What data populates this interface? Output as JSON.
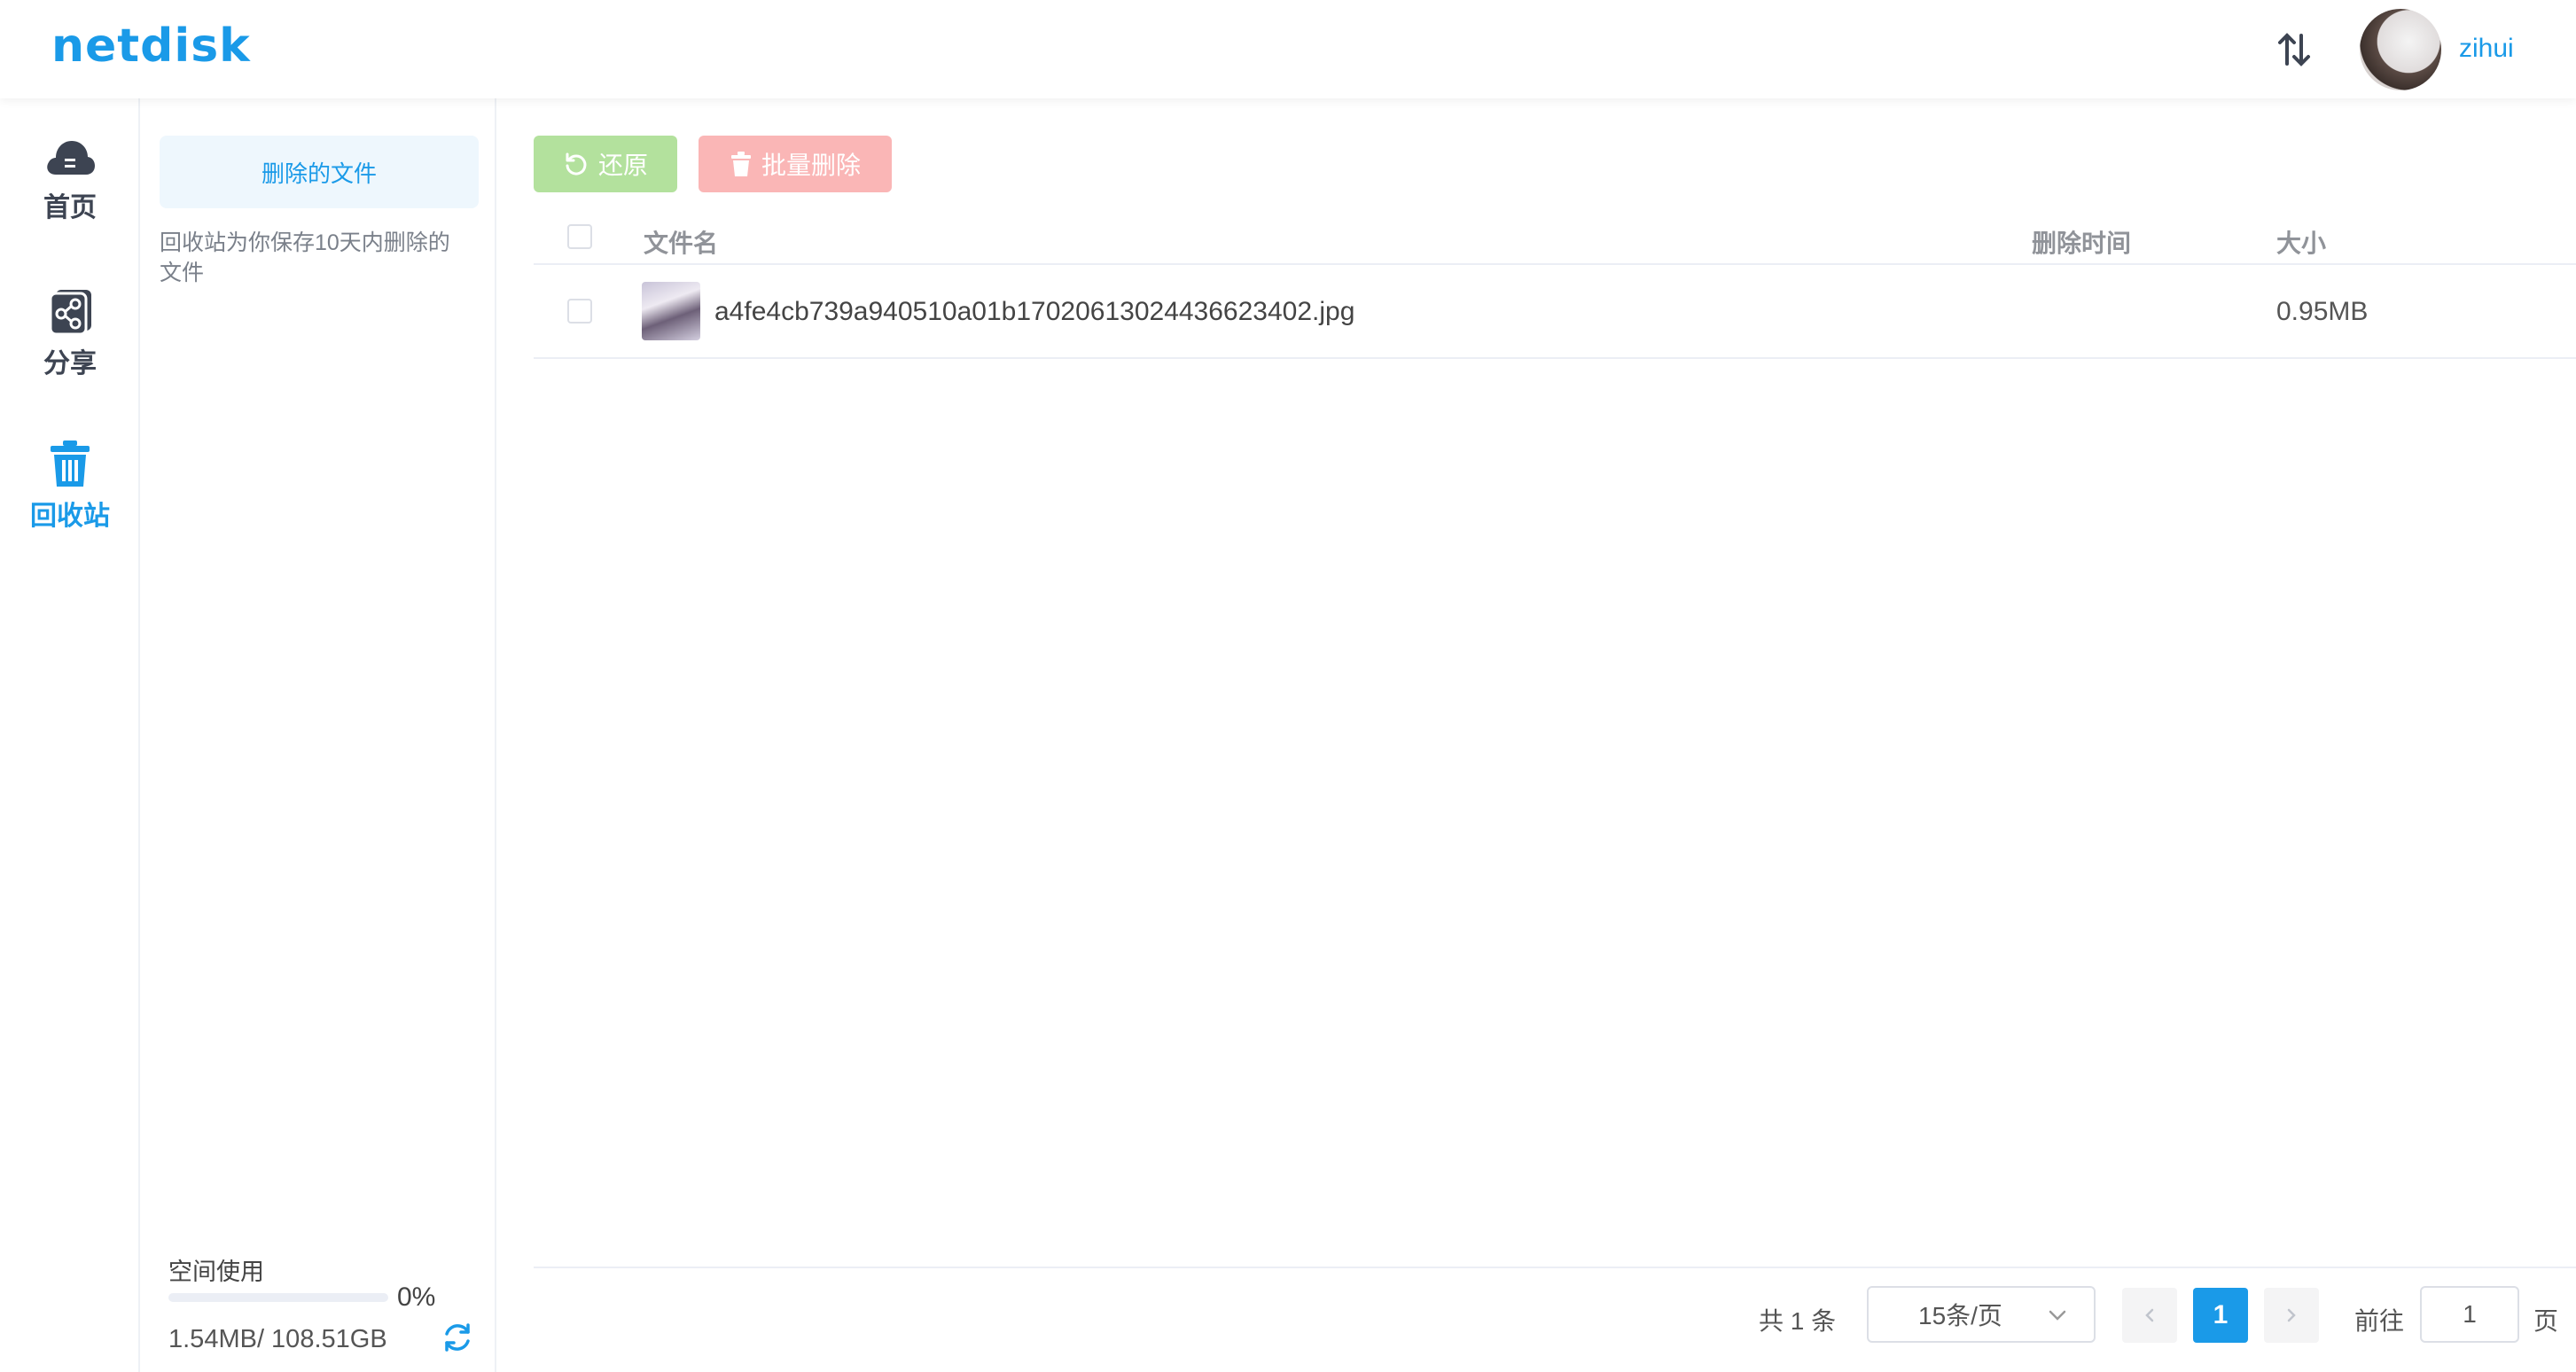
{
  "app": {
    "logo": "netdisk"
  },
  "header": {
    "username": "zihui",
    "sort_icon": "sort-arrows-icon"
  },
  "nav": {
    "items": [
      {
        "label": "首页",
        "icon": "cloud-icon",
        "active": false
      },
      {
        "label": "分享",
        "icon": "share-icon",
        "active": false
      },
      {
        "label": "回收站",
        "icon": "trash-icon",
        "active": true
      }
    ]
  },
  "subsidebar": {
    "tab_label": "删除的文件",
    "note": "回收站为你保存10天内删除的文件",
    "space_title": "空间使用",
    "space_percent_label": "0%",
    "space_used_fraction": 0.0,
    "space_amount": "1.54MB/ 108.51GB"
  },
  "toolbar": {
    "restore_label": "还原",
    "batch_delete_label": "批量删除"
  },
  "table": {
    "headers": {
      "name": "文件名",
      "deleted_time": "删除时间",
      "size": "大小"
    },
    "rows": [
      {
        "name": "a4fe4cb739a940510a01b17020613024436623402.jpg",
        "deleted_time": "",
        "size": "0.95MB"
      }
    ]
  },
  "pagination": {
    "total": "共 1 条",
    "page_size": "15条/页",
    "current_page": "1",
    "goto_label": "前往",
    "goto_value": "1",
    "page_suffix": "页"
  },
  "colors": {
    "accent": "#1a9ae8",
    "restore_bg": "#b3e19d",
    "delete_bg": "#fab6b6"
  }
}
